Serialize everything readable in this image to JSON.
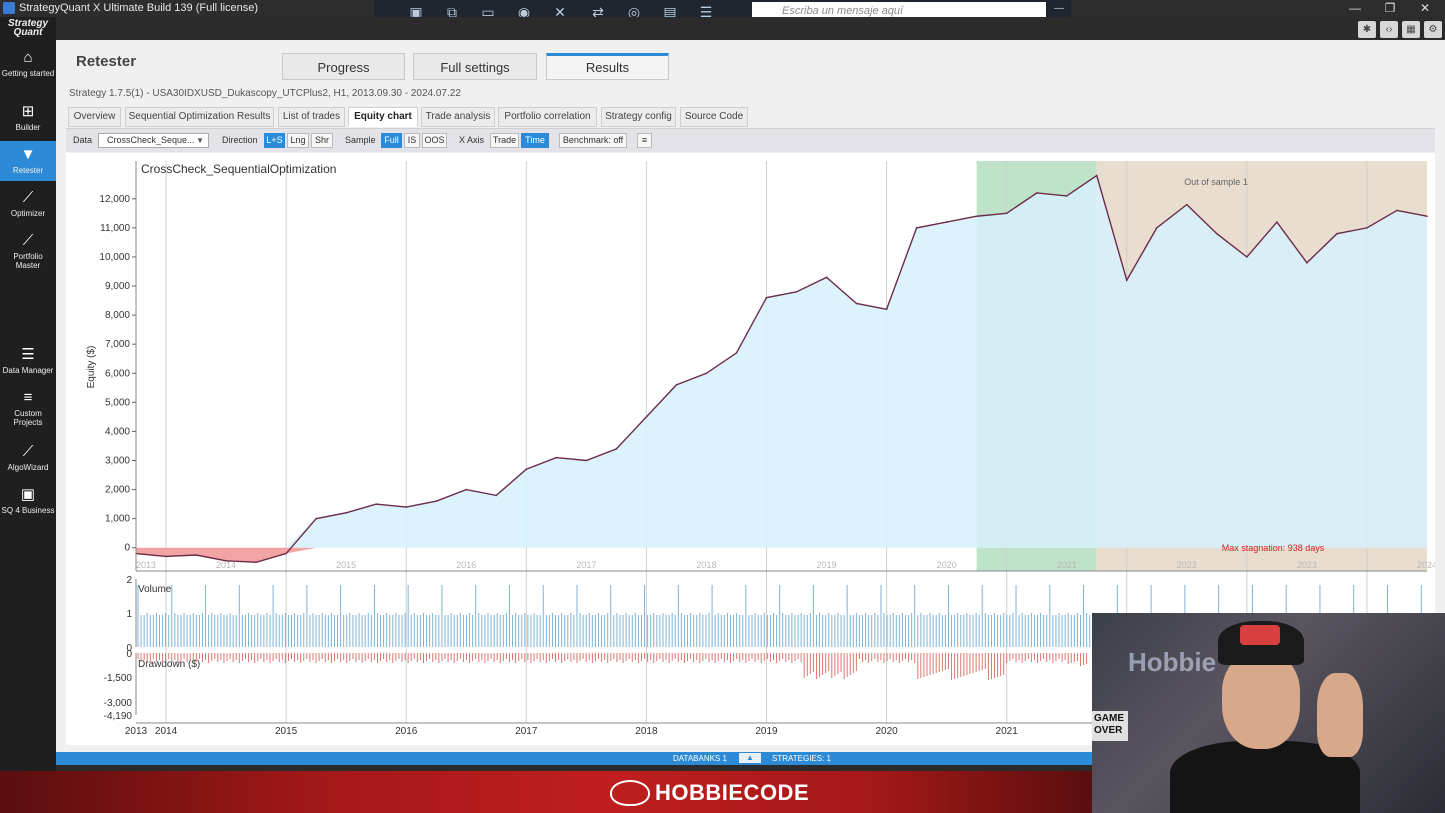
{
  "window": {
    "title": "StrategyQuant X Ultimate Build 139 (Full license)"
  },
  "overlay": {
    "message_placeholder": "Escriba un mensaje aquí"
  },
  "sidebar": {
    "logo": "Strategy Quant",
    "items": [
      {
        "label": "Getting started",
        "icon": "home-icon"
      },
      {
        "label": "Builder",
        "icon": "plus-icon"
      },
      {
        "label": "Retester",
        "icon": "filter-icon",
        "active": true
      },
      {
        "label": "Optimizer",
        "icon": "chart-icon"
      },
      {
        "label": "Portfolio Master",
        "icon": "chart-icon"
      },
      {
        "label": "Data Manager",
        "icon": "database-icon"
      },
      {
        "label": "Custom Projects",
        "icon": "stack-icon"
      },
      {
        "label": "AlgoWizard",
        "icon": "wand-icon"
      },
      {
        "label": "SQ 4 Business",
        "icon": "briefcase-icon"
      }
    ]
  },
  "main": {
    "title": "Retester",
    "tabs": [
      "Progress",
      "Full settings",
      "Results"
    ],
    "active_tab": "Results",
    "strategy_info": "Strategy 1.7.5(1) - USA30IDXUSD_Dukascopy_UTCPlus2, H1, 2013.09.30 - 2024.07.22",
    "subtabs": [
      "Overview",
      "Sequential Optimization Results",
      "List of trades",
      "Equity chart",
      "Trade analysis",
      "Portfolio correlation",
      "Strategy config",
      "Source Code"
    ],
    "active_subtab": "Equity chart"
  },
  "controls": {
    "data_label": "Data",
    "data_value": "CrossCheck_Seque...",
    "direction_label": "Direction",
    "direction_options": [
      "L+S",
      "Lng",
      "Shr"
    ],
    "sample_label": "Sample",
    "sample_options": [
      "Full",
      "IS",
      "OOS"
    ],
    "xaxis_label": "X Axis",
    "xaxis_options": [
      "Trade",
      "Time"
    ],
    "benchmark": "Benchmark: off",
    "menu_icon": "hamburger-icon"
  },
  "chart_data": {
    "type": "area",
    "title": "CrossCheck_SequentialOptimization",
    "ylabel": "Equity ($)",
    "y_ticks": [
      "0",
      "1,000",
      "2,000",
      "3,000",
      "4,000",
      "5,000",
      "6,000",
      "7,000",
      "8,000",
      "9,000",
      "10,000",
      "11,000",
      "12,000"
    ],
    "ylim": [
      -800,
      13300
    ],
    "x_year_labels": [
      "2013",
      "2014",
      "2015",
      "2016",
      "2017",
      "2018",
      "2019",
      "2020",
      "2021",
      "2022",
      "2023",
      "2024"
    ],
    "out_of_sample_label": "Out of sample 1",
    "stagnation_label": "Max stagnation: 938 days",
    "x": [
      2013.75,
      2014.0,
      2014.25,
      2014.5,
      2014.75,
      2015.0,
      2015.25,
      2015.5,
      2015.75,
      2016.0,
      2016.25,
      2016.5,
      2016.75,
      2017.0,
      2017.25,
      2017.5,
      2017.75,
      2018.0,
      2018.25,
      2018.5,
      2018.75,
      2019.0,
      2019.25,
      2019.5,
      2019.75,
      2020.0,
      2020.25,
      2020.5,
      2020.75,
      2021.0,
      2021.25,
      2021.5,
      2021.75,
      2022.0,
      2022.25,
      2022.5,
      2022.75,
      2023.0,
      2023.25,
      2023.5,
      2023.75,
      2024.0,
      2024.25,
      2024.5
    ],
    "series": [
      {
        "values": [
          -200,
          -300,
          -250,
          -450,
          -500,
          -200,
          1000,
          1200,
          1500,
          1400,
          1600,
          2000,
          1800,
          2700,
          3100,
          3000,
          3400,
          4500,
          5600,
          6000,
          6700,
          8600,
          8800,
          9300,
          8400,
          8200,
          11000,
          11200,
          11400,
          11500,
          12200,
          12100,
          12800,
          9200,
          11000,
          11800,
          10800,
          10000,
          11200,
          9800,
          10800,
          11000,
          11600,
          11400
        ]
      }
    ],
    "volume_panel": {
      "label": "Volume",
      "ticks": [
        "2",
        "1",
        "0"
      ]
    },
    "drawdown_panel": {
      "label": "Drawdown ($)",
      "ticks": [
        "0",
        "-1,500",
        "-3,000",
        "-4,190"
      ]
    }
  },
  "status": {
    "databanks": "DATABANKS 1",
    "strategies": "STRATEGIES: 1"
  },
  "banner": {
    "brand": "HOBBIECODE"
  },
  "webcam": {
    "glow_text": "Hobbie",
    "cap_text": "DSQUARED2",
    "sticker_text": "GAME OVER"
  },
  "colors": {
    "accent": "#2d8ad6",
    "equity_fill": "#d6f1fd",
    "loss_fill": "#f2a3a3",
    "equity_line": "#6b2c4a",
    "oos_green": "#bfe3c9",
    "oos_tan": "#e9ddcf",
    "volume": "#7fb3d5",
    "drawdown": "#d9776f"
  }
}
